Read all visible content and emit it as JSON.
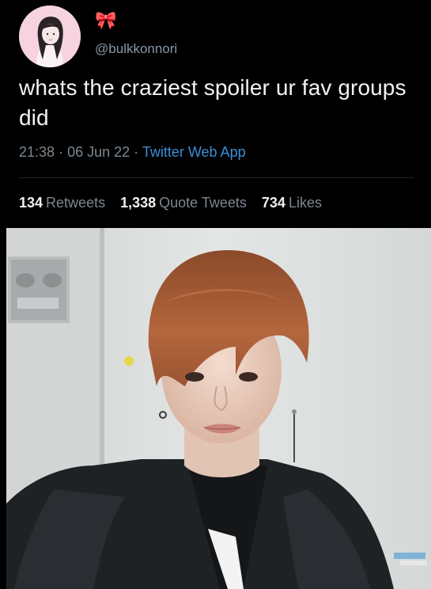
{
  "tweet": {
    "display_name_icon": "ribbon-bow-icon",
    "display_name_emoji": "🎀",
    "handle": "@bulkkonnori",
    "text": "whats the craziest spoiler ur fav groups did",
    "time": "21:38",
    "date": "06 Jun 22",
    "separator": "·",
    "source": "Twitter Web App",
    "stats": {
      "retweets_count": "134",
      "retweets_label": "Retweets",
      "quotes_count": "1,338",
      "quotes_label": "Quote Tweets",
      "likes_count": "734",
      "likes_label": "Likes"
    }
  },
  "media": {
    "type": "video-frame"
  },
  "colors": {
    "background": "#000000",
    "text": "#f2f2f2",
    "muted": "#7c8790",
    "link": "#3a8fd6",
    "accent": "#e0245e"
  }
}
